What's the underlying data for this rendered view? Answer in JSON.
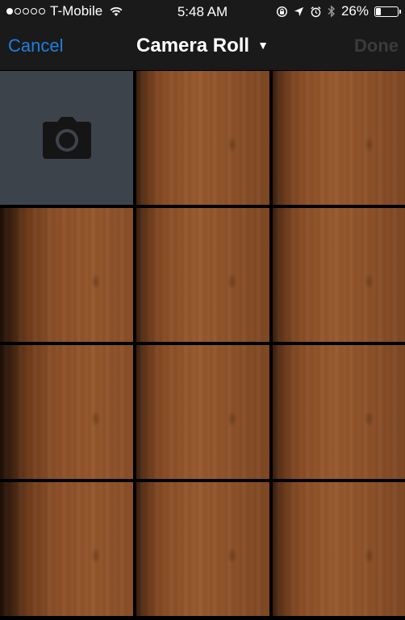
{
  "status_bar": {
    "carrier": "T-Mobile",
    "signal_bars": 1,
    "signal_total": 5,
    "time": "5:48 AM",
    "battery": "26%",
    "battery_level": 0.26
  },
  "nav": {
    "cancel_label": "Cancel",
    "title": "Camera Roll",
    "done_label": "Done",
    "accent_color": "#1f7fe0"
  },
  "grid": {
    "camera_tile_icon": "camera-icon",
    "photos": [
      {
        "kind": "wood"
      },
      {
        "kind": "wood"
      },
      {
        "kind": "wood-left"
      },
      {
        "kind": "wood"
      },
      {
        "kind": "wood"
      },
      {
        "kind": "wood-left"
      },
      {
        "kind": "wood"
      },
      {
        "kind": "wood"
      },
      {
        "kind": "wood-left"
      },
      {
        "kind": "wood"
      },
      {
        "kind": "wood"
      }
    ]
  }
}
